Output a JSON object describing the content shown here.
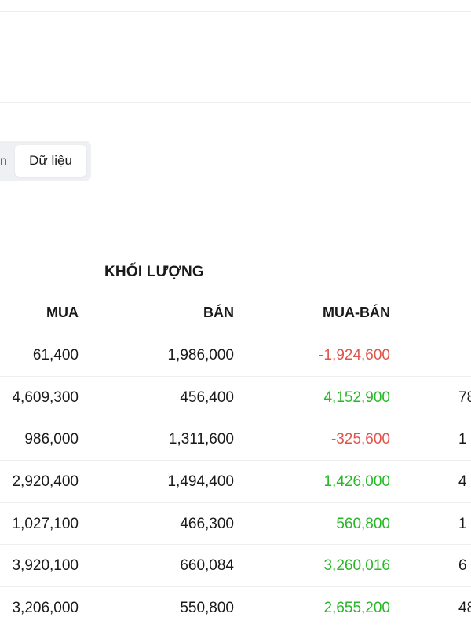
{
  "tabs": {
    "partial_label": "n",
    "active_label": "Dữ liệu"
  },
  "table": {
    "group_header": "KHỐI LƯỢNG",
    "columns": {
      "mua": "MUA",
      "ban": "BÁN",
      "mua_ban": "MUA-BÁN"
    },
    "rows": [
      {
        "mua": "61,400",
        "ban": "1,986,000",
        "mua_ban": "-1,924,600",
        "extra": ""
      },
      {
        "mua": "4,609,300",
        "ban": "456,400",
        "mua_ban": "4,152,900",
        "extra": "78"
      },
      {
        "mua": "986,000",
        "ban": "1,311,600",
        "mua_ban": "-325,600",
        "extra": "1"
      },
      {
        "mua": "2,920,400",
        "ban": "1,494,400",
        "mua_ban": "1,426,000",
        "extra": "4"
      },
      {
        "mua": "1,027,100",
        "ban": "466,300",
        "mua_ban": "560,800",
        "extra": "1"
      },
      {
        "mua": "3,920,100",
        "ban": "660,084",
        "mua_ban": "3,260,016",
        "extra": "6"
      },
      {
        "mua": "3,206,000",
        "ban": "550,800",
        "mua_ban": "2,655,200",
        "extra": "48"
      }
    ]
  },
  "colors": {
    "positive": "#27b827",
    "negative": "#e0544a"
  }
}
